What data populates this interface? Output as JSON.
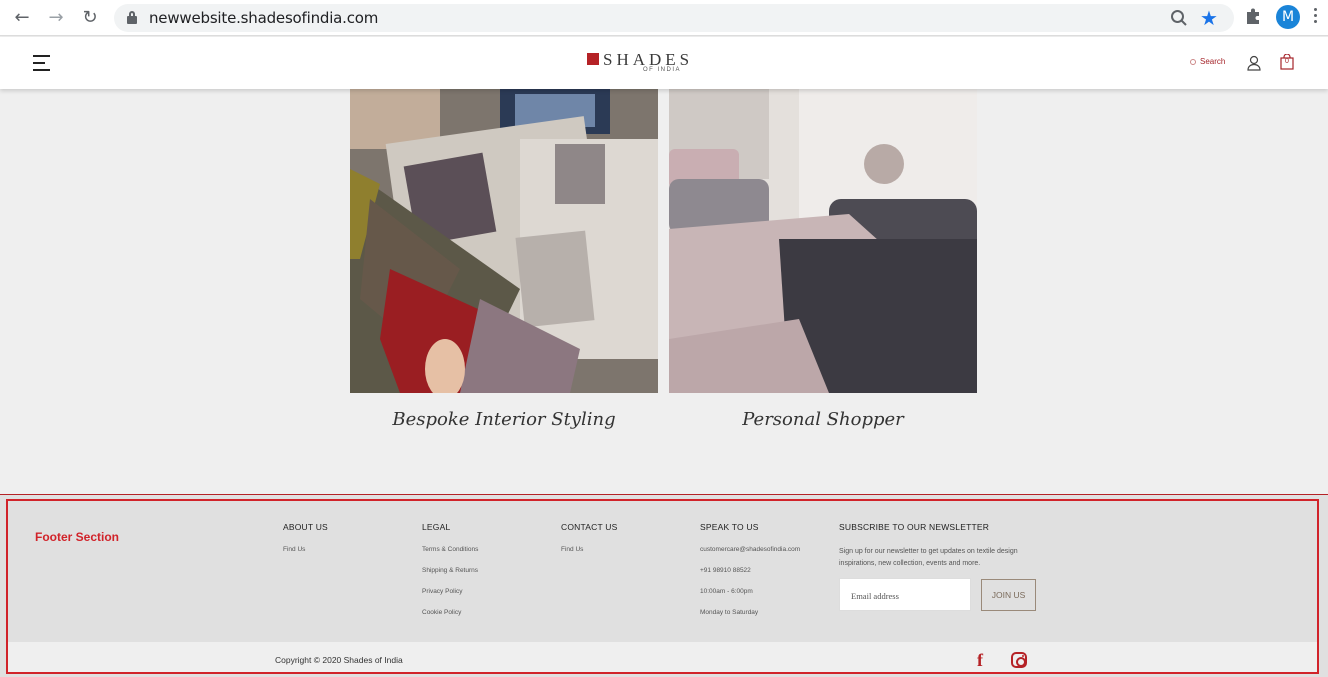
{
  "browser": {
    "url": "newwebsite.shadesofindia.com",
    "profile_initial": "M",
    "icons": [
      "back-icon",
      "forward-icon",
      "reload-icon",
      "lock-icon",
      "zoom-icon",
      "star-icon",
      "extensions-icon",
      "menu-icon"
    ]
  },
  "header": {
    "logo_main": "SHADES",
    "logo_sub": "OF INDIA",
    "search_label": "Search",
    "cart_count": "0",
    "brand_color": "#b52226"
  },
  "services": [
    {
      "caption": "Bespoke Interior Styling"
    },
    {
      "caption": "Personal Shopper"
    }
  ],
  "footer": {
    "annotation": "Footer Section",
    "about": {
      "heading": "ABOUT US",
      "links": [
        "Find Us"
      ]
    },
    "legal": {
      "heading": "LEGAL",
      "links": [
        "Terms & Conditions",
        "Shipping & Returns",
        "Privacy Policy",
        "Cookie Policy"
      ]
    },
    "contact": {
      "heading": "CONTACT US",
      "links": [
        "Find Us"
      ]
    },
    "speak": {
      "heading": "SPEAK TO US",
      "lines": [
        "customercare@shadesofindia.com",
        "+91 98910 88522",
        "10:00am - 6:00pm",
        "Monday to Saturday"
      ]
    },
    "newsletter": {
      "heading": "SUBSCRIBE TO OUR NEWSLETTER",
      "text": "Sign up for our newsletter to get updates on textile design inspirations, new collection, events and more.",
      "placeholder": "Email address",
      "button": "JOIN US"
    },
    "copyright": "Copyright © 2020 Shades of India",
    "social": [
      "facebook-icon",
      "instagram-icon"
    ]
  }
}
